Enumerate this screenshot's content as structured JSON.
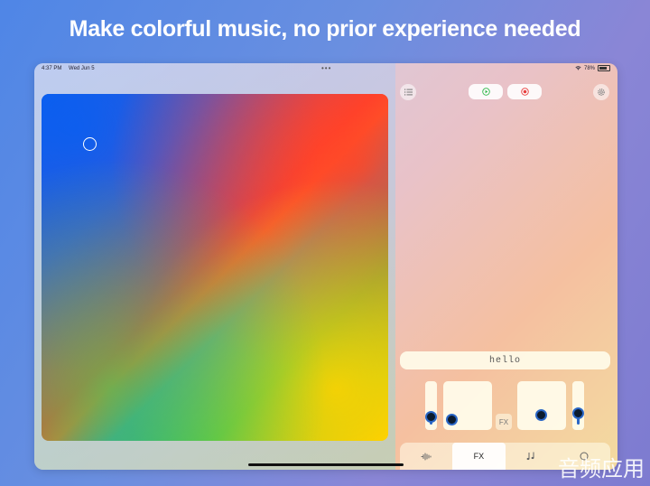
{
  "headline": "Make colorful music, no prior experience needed",
  "status_bar": {
    "time": "4:37 PM",
    "date": "Wed Jun 5",
    "battery": "78%"
  },
  "toolbar": {
    "list_icon": "list-icon",
    "play_icon": "play-icon",
    "record_icon": "record-icon",
    "settings_icon": "gear-icon",
    "play_color": "#2fb84a",
    "record_color": "#e84040"
  },
  "text_field": {
    "value": "hello"
  },
  "controls": {
    "fx_label": "FX",
    "slider_1_level": 0.25,
    "slider_2_level": 0.3,
    "knob_color": "#2a66c6"
  },
  "tabs": [
    {
      "icon": "waveform-icon",
      "label": ""
    },
    {
      "icon": "",
      "label": "FX"
    },
    {
      "icon": "music-notes-icon",
      "label": ""
    },
    {
      "icon": "circle-icon",
      "label": ""
    }
  ],
  "watermark": "音频应用"
}
